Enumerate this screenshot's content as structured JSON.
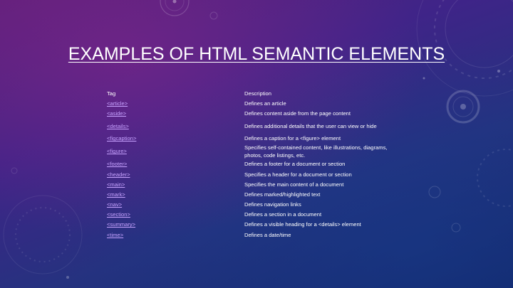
{
  "slide": {
    "title": "EXAMPLES OF HTML SEMANTIC ELEMENTS"
  },
  "table": {
    "header_tag": "Tag",
    "header_description": "Description",
    "rows": [
      {
        "tag": "<article>",
        "description": "Defines an article"
      },
      {
        "tag": "<aside>",
        "description": "Defines content aside from the page content"
      },
      {
        "tag": "<details>",
        "description": "Defines additional details that the user can view or hide"
      },
      {
        "tag": "<figcaption>",
        "description": "Defines a caption for a <figure> element"
      },
      {
        "tag": "<figure>",
        "description": "Specifies self-contained content, like illustrations, diagrams, photos, code listings, etc."
      },
      {
        "tag": "<footer>",
        "description": "Defines a footer for a document or section"
      },
      {
        "tag": "<header>",
        "description": "Specifies a header for a document or section"
      },
      {
        "tag": "<main>",
        "description": "Specifies the main content of a document"
      },
      {
        "tag": "<mark>",
        "description": "Defines marked/highlighted text"
      },
      {
        "tag": "<nav>",
        "description": "Defines navigation links"
      },
      {
        "tag": "<section>",
        "description": "Defines a section in a document"
      },
      {
        "tag": "<summary>",
        "description": "Defines a visible heading for a <details> element"
      },
      {
        "tag": "<time>",
        "description": "Defines a date/time"
      }
    ]
  },
  "colors": {
    "link": "#c7a2ff",
    "text": "#ffffff"
  }
}
